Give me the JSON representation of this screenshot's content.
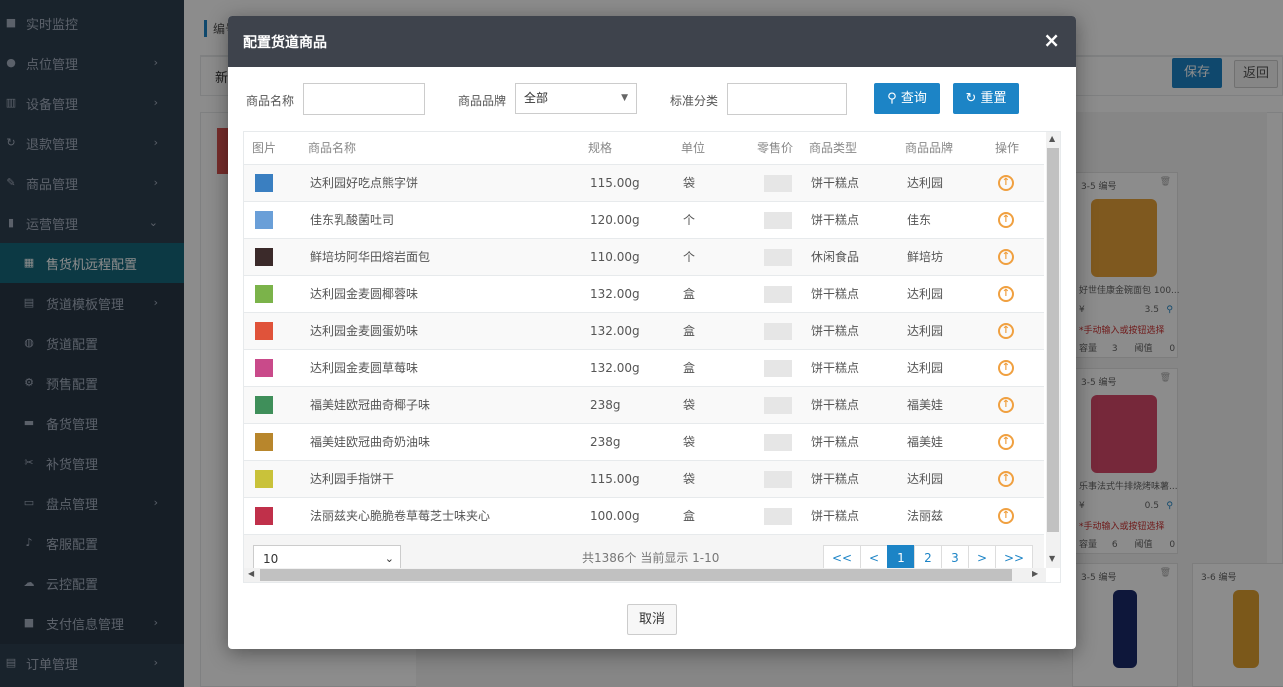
{
  "sidebar": {
    "items": [
      {
        "label": "实时监控",
        "icon": "video-icon",
        "chevron": ""
      },
      {
        "label": "点位管理",
        "icon": "map-marker-icon",
        "chevron": "›"
      },
      {
        "label": "设备管理",
        "icon": "device-icon",
        "chevron": "›"
      },
      {
        "label": "退款管理",
        "icon": "refresh-icon",
        "chevron": "›"
      },
      {
        "label": "商品管理",
        "icon": "edit-icon",
        "chevron": "›"
      },
      {
        "label": "运营管理",
        "icon": "bookmark-icon",
        "chevron": "⌄"
      },
      {
        "label": "售货机远程配置",
        "icon": "vending-icon",
        "chevron": ""
      },
      {
        "label": "货道模板管理",
        "icon": "file-icon",
        "chevron": "›"
      },
      {
        "label": "货道配置",
        "icon": "globe-icon",
        "chevron": ""
      },
      {
        "label": "预售配置",
        "icon": "gear-icon",
        "chevron": ""
      },
      {
        "label": "备货管理",
        "icon": "box-icon",
        "chevron": ""
      },
      {
        "label": "补货管理",
        "icon": "wrench-icon",
        "chevron": ""
      },
      {
        "label": "盘点管理",
        "icon": "card-icon",
        "chevron": "›"
      },
      {
        "label": "客服配置",
        "icon": "microphone-icon",
        "chevron": ""
      },
      {
        "label": "云控配置",
        "icon": "cloud-icon",
        "chevron": ""
      },
      {
        "label": "支付信息管理",
        "icon": "square-icon",
        "chevron": "›"
      },
      {
        "label": "订单管理",
        "icon": "list-icon",
        "chevron": "›"
      }
    ]
  },
  "background": {
    "tab_label": "编号",
    "toolbar_text": "新",
    "save_label": "保存",
    "back_label": "返回",
    "cards": [
      {
        "no": "3-5  编号",
        "name": "好世佳康金碗面包 100...",
        "price_symbol": "¥",
        "price": "3.5",
        "note": "*手动输入或按钮选择",
        "cap_label": "容量",
        "cap": "3",
        "threshold_label": "阈值",
        "threshold": "0"
      },
      {
        "no": "3-5  编号",
        "name": "乐事法式牛排烧烤味薯...",
        "price_symbol": "¥",
        "price": "0.5",
        "note": "*手动输入或按钮选择",
        "cap_label": "容量",
        "cap": "6",
        "threshold_label": "阈值",
        "threshold": "0"
      },
      {
        "no": "3-5  编号"
      },
      {
        "no": "3-6  编号"
      }
    ]
  },
  "modal": {
    "title": "配置货道商品",
    "filters": {
      "name_label": "商品名称",
      "name_value": "",
      "brand_label": "商品品牌",
      "brand_value": "全部",
      "category_label": "标准分类",
      "category_value": "",
      "query_label": "查询",
      "reset_label": "重置"
    },
    "table": {
      "headers": [
        "图片",
        "商品名称",
        "规格",
        "单位",
        "零售价",
        "商品类型",
        "商品品牌",
        "操作"
      ],
      "rows": [
        {
          "name": "达利园好吃点熊字饼",
          "spec": "115.00g",
          "unit": "袋",
          "type": "饼干糕点",
          "brand": "达利园",
          "thumb_color": "#3a7fc1"
        },
        {
          "name": "佳东乳酸菌吐司",
          "spec": "120.00g",
          "unit": "个",
          "type": "饼干糕点",
          "brand": "佳东",
          "thumb_color": "#6a9fd8"
        },
        {
          "name": "鲜培坊阿华田熔岩面包",
          "spec": "110.00g",
          "unit": "个",
          "type": "休闲食品",
          "brand": "鲜培坊",
          "thumb_color": "#3b2a2a"
        },
        {
          "name": "达利园金麦圆椰蓉味",
          "spec": "132.00g",
          "unit": "盒",
          "type": "饼干糕点",
          "brand": "达利园",
          "thumb_color": "#7bb34a"
        },
        {
          "name": "达利园金麦圆蛋奶味",
          "spec": "132.00g",
          "unit": "盒",
          "type": "饼干糕点",
          "brand": "达利园",
          "thumb_color": "#e0533a"
        },
        {
          "name": "达利园金麦圆草莓味",
          "spec": "132.00g",
          "unit": "盒",
          "type": "饼干糕点",
          "brand": "达利园",
          "thumb_color": "#c94a8a"
        },
        {
          "name": "福美娃欧冠曲奇椰子味",
          "spec": "238g",
          "unit": "袋",
          "type": "饼干糕点",
          "brand": "福美娃",
          "thumb_color": "#3f8f5a"
        },
        {
          "name": "福美娃欧冠曲奇奶油味",
          "spec": "238g",
          "unit": "袋",
          "type": "饼干糕点",
          "brand": "福美娃",
          "thumb_color": "#b8862c"
        },
        {
          "name": "达利园手指饼干",
          "spec": "115.00g",
          "unit": "袋",
          "type": "饼干糕点",
          "brand": "达利园",
          "thumb_color": "#c9c23a"
        },
        {
          "name": "法丽兹夹心脆脆卷草莓芝士味夹心",
          "spec": "100.00g",
          "unit": "盒",
          "type": "饼干糕点",
          "brand": "法丽兹",
          "thumb_color": "#c0304a"
        }
      ]
    },
    "footer": {
      "page_size": "10",
      "info": "共1386个 当前显示 1-10",
      "pages": [
        "<<",
        "<",
        "1",
        "2",
        "3",
        ">",
        ">>"
      ],
      "active_page": "1"
    },
    "cancel_label": "取消",
    "close_glyph": "×"
  }
}
